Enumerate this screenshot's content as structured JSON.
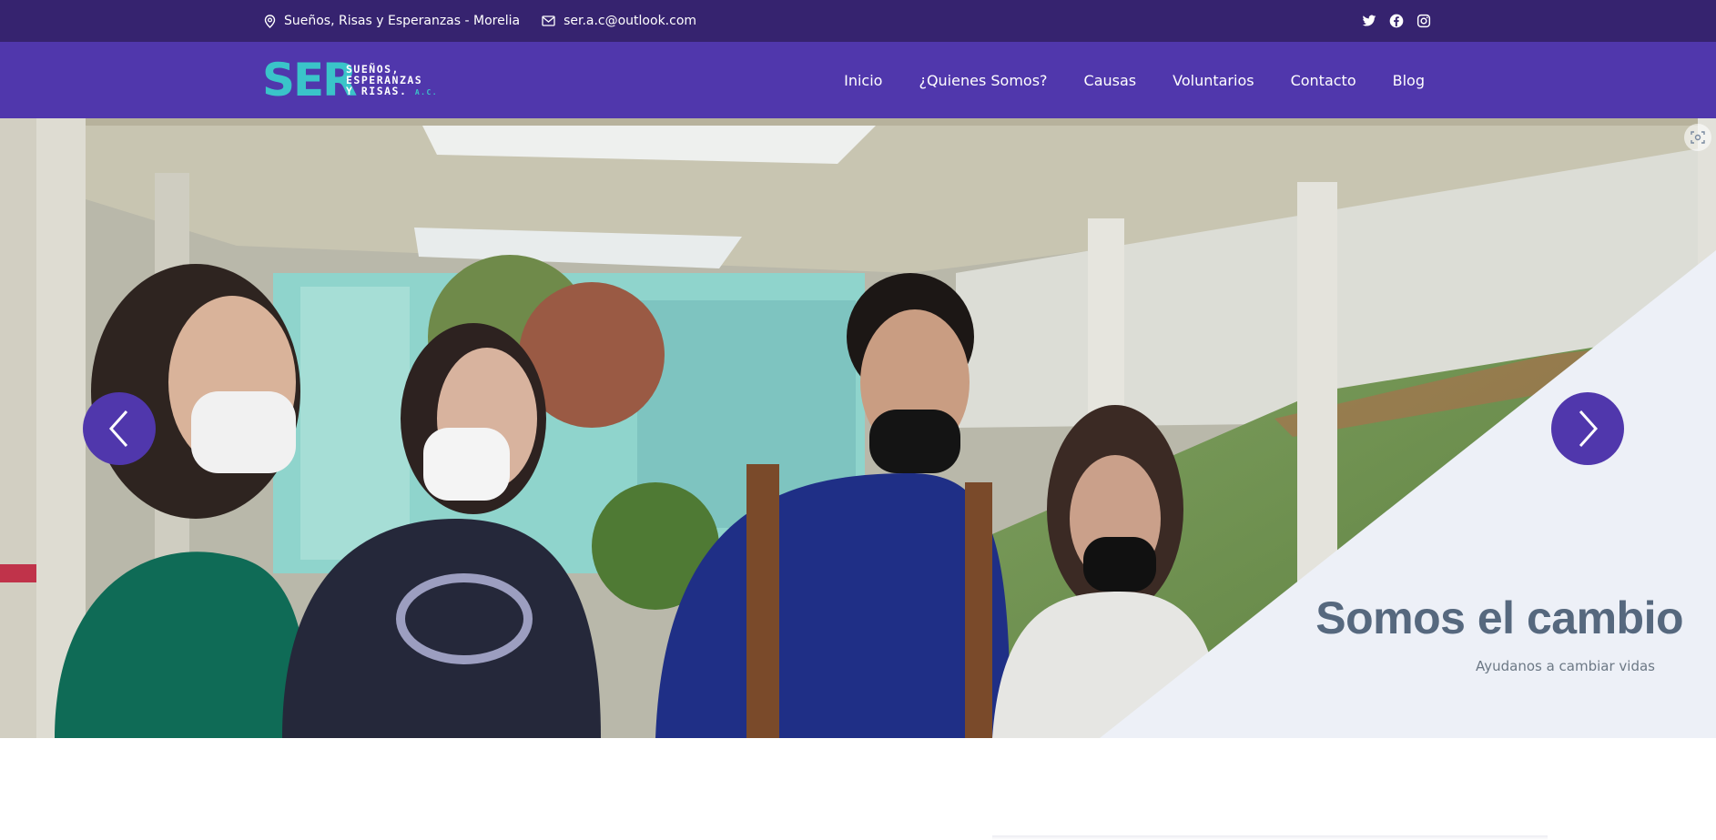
{
  "topbar": {
    "location": "Sueños, Risas y Esperanzas - Morelia",
    "email": "ser.a.c@outlook.com",
    "icons": [
      "map-pin-icon",
      "envelope-icon",
      "twitter-icon",
      "facebook-icon",
      "instagram-icon"
    ]
  },
  "logo": {
    "mark": "SER",
    "line1": "SUEÑOS,",
    "line2": "ESPERANZAS",
    "line3": "Y RISAS.",
    "suffix": "A.C."
  },
  "nav": {
    "items": [
      "Inicio",
      "¿Quienes Somos?",
      "Causas",
      "Voluntarios",
      "Contacto",
      "Blog"
    ]
  },
  "hero": {
    "title": "Somos el cambio",
    "subtitle": "Ayudanos a cambiar vidas",
    "prev_icon": "chevron-left-icon",
    "next_icon": "chevron-right-icon"
  },
  "colors": {
    "topbar": "#36236f",
    "navbar": "#5037ac",
    "accent": "#3ac4c9",
    "title": "#56687e",
    "panel": "#edf0f7"
  }
}
